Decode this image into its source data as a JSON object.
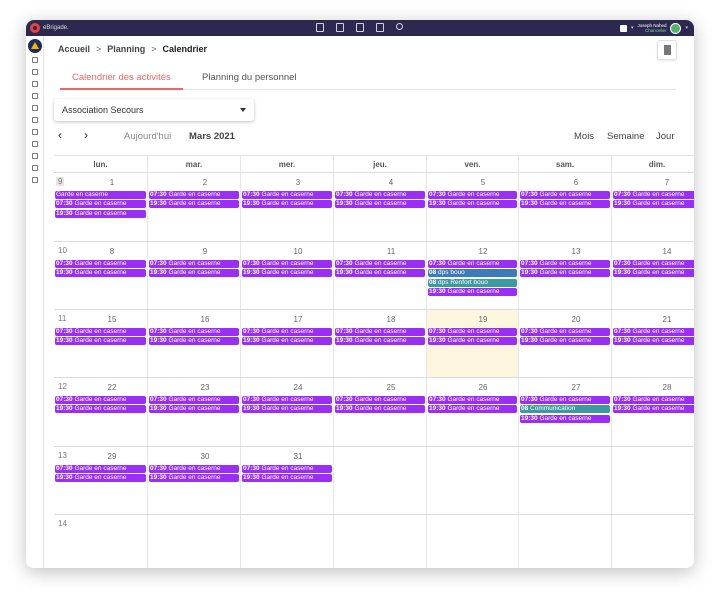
{
  "app": {
    "brand": "eBrigade."
  },
  "user": {
    "name": "Joseph Nahed",
    "role": "Chancelier"
  },
  "breadcrumb": {
    "home": "Accueil",
    "section": "Planning",
    "current": "Calendrier",
    "sep": ">"
  },
  "tabs": [
    {
      "label": "Calendrier des activités"
    },
    {
      "label": "Planning du personnel"
    }
  ],
  "filter": {
    "selected": "Association Secours"
  },
  "nav": {
    "prev": "‹",
    "next": "›",
    "today": "Aujourd'hui",
    "title": "Mars 2021",
    "views": [
      "Mois",
      "Semaine",
      "Jour"
    ]
  },
  "days_of_week": [
    "lun.",
    "mar.",
    "mer.",
    "jeu.",
    "ven.",
    "sam.",
    "dim."
  ],
  "weeks": [
    {
      "week_number": "9",
      "days": [
        {
          "date": "1",
          "events": [
            {
              "time": "",
              "label": "Garde en caserne",
              "color": "purple"
            },
            {
              "time": "07:30",
              "label": "Garde en caserne",
              "color": "purple"
            },
            {
              "time": "19:30",
              "label": "Garde en caserne",
              "color": "purple"
            }
          ]
        },
        {
          "date": "2",
          "events": [
            {
              "time": "07:30",
              "label": "Garde en caserne",
              "color": "purple"
            },
            {
              "time": "19:30",
              "label": "Garde en caserne",
              "color": "purple"
            }
          ]
        },
        {
          "date": "3",
          "events": [
            {
              "time": "07:30",
              "label": "Garde en caserne",
              "color": "purple"
            },
            {
              "time": "19:30",
              "label": "Garde en caserne",
              "color": "purple"
            }
          ]
        },
        {
          "date": "4",
          "events": [
            {
              "time": "07:30",
              "label": "Garde en caserne",
              "color": "purple"
            },
            {
              "time": "19:30",
              "label": "Garde en caserne",
              "color": "purple"
            }
          ]
        },
        {
          "date": "5",
          "events": [
            {
              "time": "07:30",
              "label": "Garde en caserne",
              "color": "purple"
            },
            {
              "time": "19:30",
              "label": "Garde en caserne",
              "color": "purple"
            }
          ]
        },
        {
          "date": "6",
          "events": [
            {
              "time": "07:30",
              "label": "Garde en caserne",
              "color": "purple"
            },
            {
              "time": "19:30",
              "label": "Garde en caserne",
              "color": "purple"
            }
          ]
        },
        {
          "date": "7",
          "events": [
            {
              "time": "07:30",
              "label": "Garde en caserne",
              "color": "purple"
            },
            {
              "time": "19:30",
              "label": "Garde en caserne",
              "color": "purple"
            }
          ]
        }
      ]
    },
    {
      "week_number": "10",
      "days": [
        {
          "date": "8",
          "events": [
            {
              "time": "07:30",
              "label": "Garde en caserne",
              "color": "purple"
            },
            {
              "time": "19:30",
              "label": "Garde en caserne",
              "color": "purple"
            }
          ]
        },
        {
          "date": "9",
          "events": [
            {
              "time": "07:30",
              "label": "Garde en caserne",
              "color": "purple"
            },
            {
              "time": "19:30",
              "label": "Garde en caserne",
              "color": "purple"
            }
          ]
        },
        {
          "date": "10",
          "events": [
            {
              "time": "07:30",
              "label": "Garde en caserne",
              "color": "purple"
            },
            {
              "time": "19:30",
              "label": "Garde en caserne",
              "color": "purple"
            }
          ]
        },
        {
          "date": "11",
          "events": [
            {
              "time": "07:30",
              "label": "Garde en caserne",
              "color": "purple"
            },
            {
              "time": "19:30",
              "label": "Garde en caserne",
              "color": "purple"
            }
          ]
        },
        {
          "date": "12",
          "events": [
            {
              "time": "07:30",
              "label": "Garde en caserne",
              "color": "purple"
            },
            {
              "time": "08",
              "label": "dps bouo",
              "color": "blue"
            },
            {
              "time": "08",
              "label": "dps Renfort bouo",
              "color": "teal"
            },
            {
              "time": "19:30",
              "label": "Garde en caserne",
              "color": "purple"
            }
          ]
        },
        {
          "date": "13",
          "events": [
            {
              "time": "07:30",
              "label": "Garde en caserne",
              "color": "purple"
            },
            {
              "time": "19:30",
              "label": "Garde en caserne",
              "color": "purple"
            }
          ]
        },
        {
          "date": "14",
          "events": [
            {
              "time": "07:30",
              "label": "Garde en caserne",
              "color": "purple"
            },
            {
              "time": "19:30",
              "label": "Garde en caserne",
              "color": "purple"
            }
          ]
        }
      ]
    },
    {
      "week_number": "11",
      "days": [
        {
          "date": "15",
          "events": [
            {
              "time": "07:30",
              "label": "Garde en caserne",
              "color": "purple"
            },
            {
              "time": "19:30",
              "label": "Garde en caserne",
              "color": "purple"
            }
          ]
        },
        {
          "date": "16",
          "events": [
            {
              "time": "07:30",
              "label": "Garde en caserne",
              "color": "purple"
            },
            {
              "time": "19:30",
              "label": "Garde en caserne",
              "color": "purple"
            }
          ]
        },
        {
          "date": "17",
          "events": [
            {
              "time": "07:30",
              "label": "Garde en caserne",
              "color": "purple"
            },
            {
              "time": "19:30",
              "label": "Garde en caserne",
              "color": "purple"
            }
          ]
        },
        {
          "date": "18",
          "events": [
            {
              "time": "07:30",
              "label": "Garde en caserne",
              "color": "purple"
            },
            {
              "time": "19:30",
              "label": "Garde en caserne",
              "color": "purple"
            }
          ]
        },
        {
          "date": "19",
          "today": true,
          "events": [
            {
              "time": "07:30",
              "label": "Garde en caserne",
              "color": "purple"
            },
            {
              "time": "19:30",
              "label": "Garde en caserne",
              "color": "purple"
            }
          ]
        },
        {
          "date": "20",
          "events": [
            {
              "time": "07:30",
              "label": "Garde en caserne",
              "color": "purple"
            },
            {
              "time": "19:30",
              "label": "Garde en caserne",
              "color": "purple"
            }
          ]
        },
        {
          "date": "21",
          "events": [
            {
              "time": "07:30",
              "label": "Garde en caserne",
              "color": "purple"
            },
            {
              "time": "19:30",
              "label": "Garde en caserne",
              "color": "purple"
            }
          ]
        }
      ]
    },
    {
      "week_number": "12",
      "days": [
        {
          "date": "22",
          "events": [
            {
              "time": "07:30",
              "label": "Garde en caserne",
              "color": "purple"
            },
            {
              "time": "19:30",
              "label": "Garde en caserne",
              "color": "purple"
            }
          ]
        },
        {
          "date": "23",
          "events": [
            {
              "time": "07:30",
              "label": "Garde en caserne",
              "color": "purple"
            },
            {
              "time": "19:30",
              "label": "Garde en caserne",
              "color": "purple"
            }
          ]
        },
        {
          "date": "24",
          "events": [
            {
              "time": "07:30",
              "label": "Garde en caserne",
              "color": "purple"
            },
            {
              "time": "19:30",
              "label": "Garde en caserne",
              "color": "purple"
            }
          ]
        },
        {
          "date": "25",
          "events": [
            {
              "time": "07:30",
              "label": "Garde en caserne",
              "color": "purple"
            },
            {
              "time": "19:30",
              "label": "Garde en caserne",
              "color": "purple"
            }
          ]
        },
        {
          "date": "26",
          "events": [
            {
              "time": "07:30",
              "label": "Garde en caserne",
              "color": "purple"
            },
            {
              "time": "19:30",
              "label": "Garde en caserne",
              "color": "purple"
            }
          ]
        },
        {
          "date": "27",
          "events": [
            {
              "time": "07:30",
              "label": "Garde en caserne",
              "color": "purple"
            },
            {
              "time": "08",
              "label": "Communication",
              "color": "teal"
            },
            {
              "time": "19:30",
              "label": "Garde en caserne",
              "color": "purple"
            }
          ]
        },
        {
          "date": "28",
          "events": [
            {
              "time": "07:30",
              "label": "Garde en caserne",
              "color": "purple"
            },
            {
              "time": "19:30",
              "label": "Garde en caserne",
              "color": "purple"
            }
          ]
        }
      ]
    },
    {
      "week_number": "13",
      "days": [
        {
          "date": "29",
          "events": [
            {
              "time": "07:30",
              "label": "Garde en caserne",
              "color": "purple"
            },
            {
              "time": "19:30",
              "label": "Garde en caserne",
              "color": "purple"
            }
          ]
        },
        {
          "date": "30",
          "events": [
            {
              "time": "07:30",
              "label": "Garde en caserne",
              "color": "purple"
            },
            {
              "time": "19:30",
              "label": "Garde en caserne",
              "color": "purple"
            }
          ]
        },
        {
          "date": "31",
          "events": [
            {
              "time": "07:30",
              "label": "Garde en caserne",
              "color": "purple"
            },
            {
              "time": "19:30",
              "label": "Garde en caserne",
              "color": "purple"
            }
          ]
        },
        {
          "date": "",
          "events": []
        },
        {
          "date": "",
          "events": []
        },
        {
          "date": "",
          "events": []
        },
        {
          "date": "",
          "events": []
        }
      ]
    },
    {
      "week_number": "14",
      "days": [
        {
          "date": "",
          "events": []
        },
        {
          "date": "",
          "events": []
        },
        {
          "date": "",
          "events": []
        },
        {
          "date": "",
          "events": []
        },
        {
          "date": "",
          "events": []
        },
        {
          "date": "",
          "events": []
        },
        {
          "date": "",
          "events": []
        }
      ]
    }
  ],
  "colors": {
    "purple": "#9a2ef5",
    "blue": "#3d7ab8",
    "teal": "#3d9aa3",
    "accent": "#f06666",
    "topbar": "#2c2950",
    "today_bg": "#fcf6de"
  },
  "topbar_icons": [
    "calendar-icon",
    "calendar-icon",
    "list-icon",
    "trash-icon",
    "search-icon"
  ],
  "sidebar_icons": [
    "user-icon",
    "calendar-icon",
    "document-icon",
    "calendar-icon",
    "globe-icon",
    "target-icon",
    "chart-icon",
    "file-icon",
    "mail-icon",
    "list-icon",
    "settings-icon"
  ]
}
